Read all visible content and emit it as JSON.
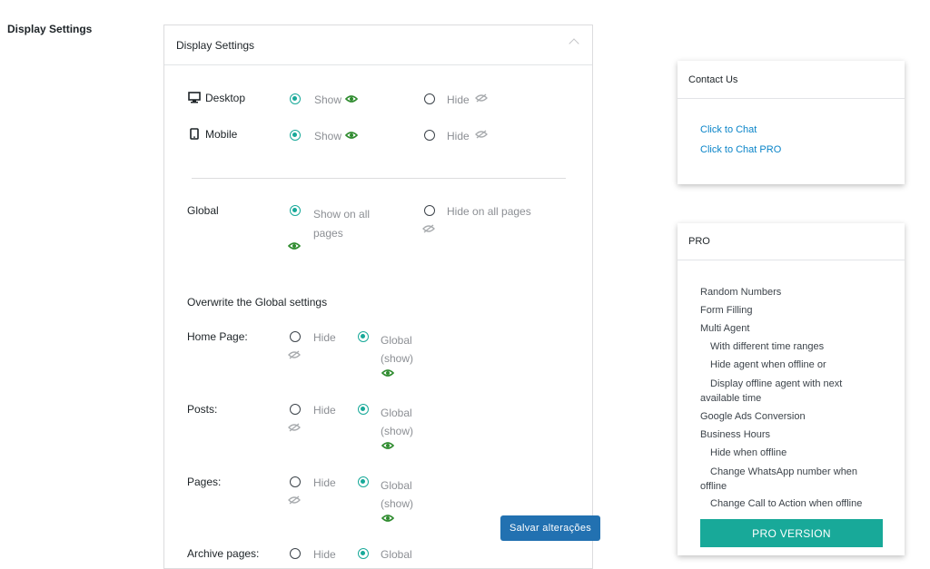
{
  "page_heading": "Display Settings",
  "panel": {
    "title": "Display Settings",
    "devices": [
      {
        "label": "Desktop",
        "show": "Show",
        "hide": "Hide",
        "selected": "show"
      },
      {
        "label": "Mobile",
        "show": "Show",
        "hide": "Hide",
        "selected": "show"
      }
    ],
    "global": {
      "label": "Global",
      "show": "Show on all pages",
      "hide": "Hide on all pages",
      "selected": "show"
    },
    "overwrite_heading": "Overwrite the Global settings",
    "pages": [
      {
        "label": "Home Page:",
        "hide": "Hide",
        "global": "Global (show)",
        "selected": "global"
      },
      {
        "label": "Posts:",
        "hide": "Hide",
        "global": "Global (show)",
        "selected": "global"
      },
      {
        "label": "Pages:",
        "hide": "Hide",
        "global": "Global (show)",
        "selected": "global"
      },
      {
        "label": "Archive pages:",
        "hide": "Hide",
        "global": "Global",
        "selected": "global"
      }
    ]
  },
  "save_button": "Salvar alterações",
  "contact": {
    "title": "Contact Us",
    "links": [
      "Click to Chat",
      "Click to Chat PRO"
    ]
  },
  "pro": {
    "title": "PRO",
    "items": [
      {
        "text": "Random Numbers",
        "indent": false
      },
      {
        "text": "Form Filling",
        "indent": false
      },
      {
        "text": "Multi Agent",
        "indent": false
      },
      {
        "text": "With different time ranges",
        "indent": true
      },
      {
        "text": "Hide agent when offline or",
        "indent": true
      },
      {
        "text": "Display offline agent with next available time",
        "indent": true
      },
      {
        "text": "Google Ads Conversion",
        "indent": false
      },
      {
        "text": "Business Hours",
        "indent": false
      },
      {
        "text": "Hide when offline",
        "indent": true
      },
      {
        "text": "Change WhatsApp number when offline",
        "indent": true
      },
      {
        "text": "Change Call to Action when offline",
        "indent": true
      }
    ],
    "button": "PRO VERSION"
  },
  "colors": {
    "accent": "#18a999",
    "link": "#0a84c8",
    "save": "#2271b1"
  }
}
